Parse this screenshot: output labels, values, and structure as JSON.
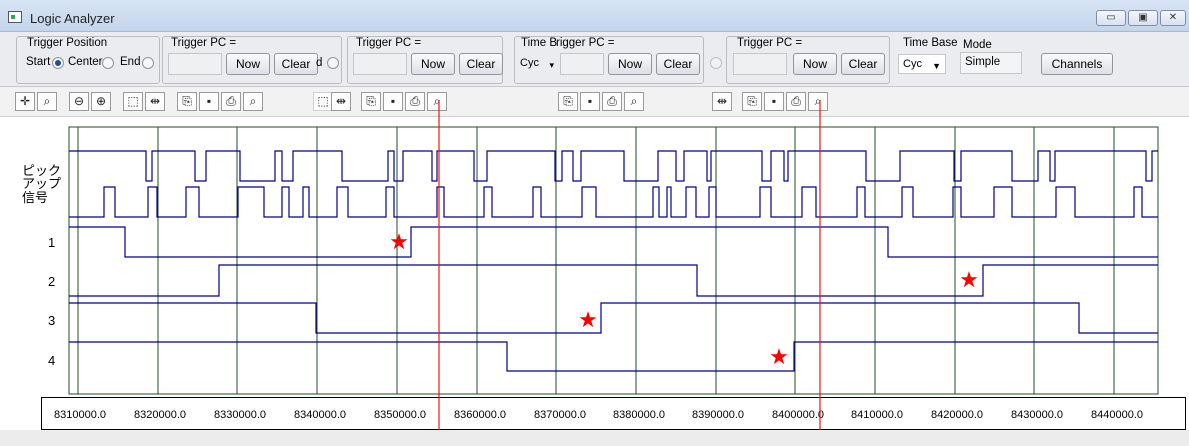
{
  "window": {
    "title": "Logic Analyzer",
    "minimize": "▭",
    "maximize": "▣",
    "close": "✕"
  },
  "trigger_position": {
    "label": "Trigger Position",
    "options": [
      "Start",
      "Center",
      "End"
    ],
    "selected": "Start"
  },
  "trigger_groups": [
    {
      "label": "Trigger PC =",
      "now": "Now",
      "clear": "Clear",
      "partial": "d"
    },
    {
      "label": "Trigger PC =",
      "now": "Now",
      "clear": "Clear"
    },
    {
      "label": "Time B",
      "label2": "rigger PC =",
      "select": "Cyc",
      "now": "Now",
      "clear": "Clear"
    },
    {
      "label": "Trigger PC =",
      "now": "Now",
      "clear": "Clear"
    }
  ],
  "time_base": {
    "label": "Time Base",
    "value": "Cyc"
  },
  "mode": {
    "label": "Mode",
    "value": "Simple"
  },
  "channels_button": "Channels",
  "signal_labels": {
    "pickup": "ピック\nアップ\n信号",
    "rows": [
      "1",
      "2",
      "3",
      "4"
    ]
  },
  "markers": {
    "symbol": "★",
    "color": "#ff0000"
  },
  "cursor_color": "#e21b1b",
  "trace_color": "#00008b",
  "grid_color": "#1f4d1f",
  "axis": {
    "ticks": [
      "8310000.0",
      "8320000.0",
      "8330000.0",
      "8340000.0",
      "8350000.0",
      "8360000.0",
      "8370000.0",
      "8380000.0",
      "8390000.0",
      "8400000.0",
      "8410000.0",
      "8420000.0",
      "8430000.0",
      "8440000.0"
    ]
  }
}
